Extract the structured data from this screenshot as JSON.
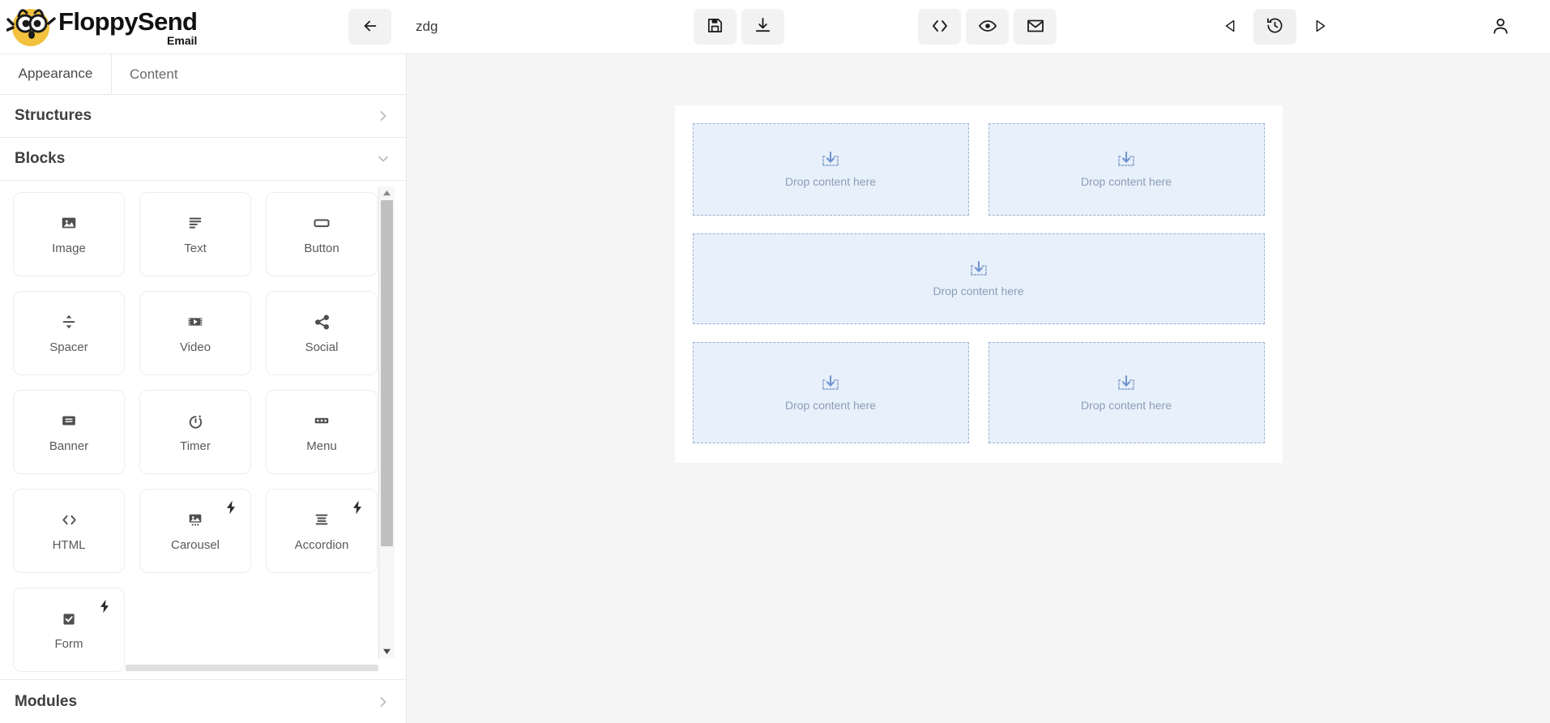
{
  "brand": {
    "name": "FloppySend",
    "subtitle": "Email",
    "logo_icon": "owl-mascot-logo"
  },
  "toolbar": {
    "back_icon": "arrow-left-icon",
    "document_title": "zdg",
    "save_icon": "floppy-disk-save-icon",
    "download_icon": "download-icon",
    "code_icon": "code-brackets-icon",
    "preview_icon": "eye-preview-icon",
    "email_icon": "envelope-send-test-icon",
    "undo_icon": "triangle-left-undo-icon",
    "history_icon": "clock-history-icon",
    "redo_icon": "triangle-right-redo-icon",
    "account_icon": "user-account-icon"
  },
  "sidebar": {
    "tabs": [
      {
        "label": "Appearance",
        "selected": true
      },
      {
        "label": "Content",
        "selected": false
      }
    ],
    "sections": [
      {
        "label": "Structures",
        "expanded": false,
        "chevron": "chevron-right-icon"
      },
      {
        "label": "Blocks",
        "expanded": true,
        "chevron": "chevron-down-icon"
      },
      {
        "label": "Modules",
        "expanded": false,
        "chevron": "chevron-right-icon"
      }
    ],
    "blocks": [
      {
        "label": "Image",
        "icon": "image-icon",
        "premium": false
      },
      {
        "label": "Text",
        "icon": "text-lines-icon",
        "premium": false
      },
      {
        "label": "Button",
        "icon": "button-icon",
        "premium": false
      },
      {
        "label": "Spacer",
        "icon": "spacer-icon",
        "premium": false
      },
      {
        "label": "Video",
        "icon": "video-icon",
        "premium": false
      },
      {
        "label": "Social",
        "icon": "share-social-icon",
        "premium": false
      },
      {
        "label": "Banner",
        "icon": "banner-icon",
        "premium": false
      },
      {
        "label": "Timer",
        "icon": "timer-icon",
        "premium": false
      },
      {
        "label": "Menu",
        "icon": "menu-icon",
        "premium": false
      },
      {
        "label": "HTML",
        "icon": "code-brackets-icon",
        "premium": false
      },
      {
        "label": "Carousel",
        "icon": "carousel-icon",
        "premium": true
      },
      {
        "label": "Accordion",
        "icon": "accordion-icon",
        "premium": true
      },
      {
        "label": "Form",
        "icon": "checkbox-form-icon",
        "premium": true
      }
    ]
  },
  "canvas": {
    "drop_label": "Drop content here",
    "drop_icon": "drop-here-arrow-icon",
    "rows": [
      {
        "columns": 2
      },
      {
        "columns": 1
      },
      {
        "columns": 2
      }
    ]
  },
  "colors": {
    "dropzone_fill": "#e8f0fc",
    "dropzone_border": "#9cb3d4",
    "dropzone_text": "#8c9db5",
    "canvas_bg": "#f5f5f5",
    "logo_yellow": "#f2c23e"
  }
}
